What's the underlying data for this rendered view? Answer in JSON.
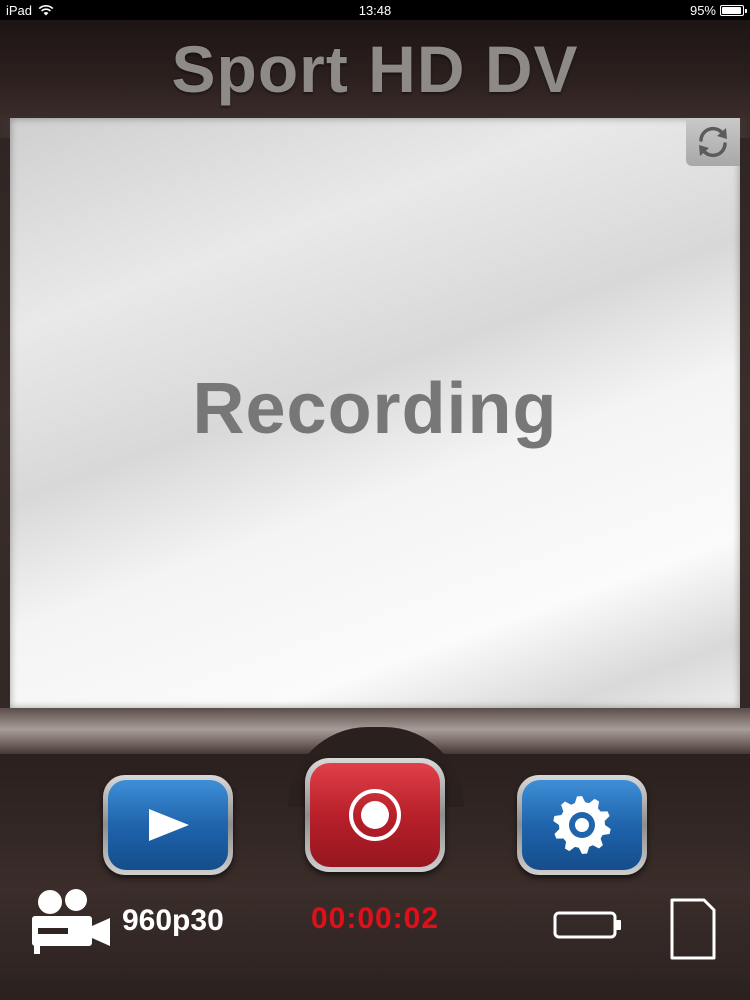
{
  "status_bar": {
    "device": "iPad",
    "time": "13:48",
    "battery": "95%",
    "battery_level": 0.95
  },
  "app": {
    "title": "Sport HD DV"
  },
  "viewfinder": {
    "status_text": "Recording"
  },
  "controls": {
    "play_icon": "play-icon",
    "record_icon": "record-icon",
    "settings_icon": "gear-icon",
    "switch_icon": "refresh-icon"
  },
  "info": {
    "resolution": "960p30",
    "timer": "00:00:02"
  },
  "colors": {
    "accent_blue": "#1f64ad",
    "record_red": "#b8202a",
    "timer_red": "#e0101a",
    "panel_brown": "#2a201e"
  }
}
